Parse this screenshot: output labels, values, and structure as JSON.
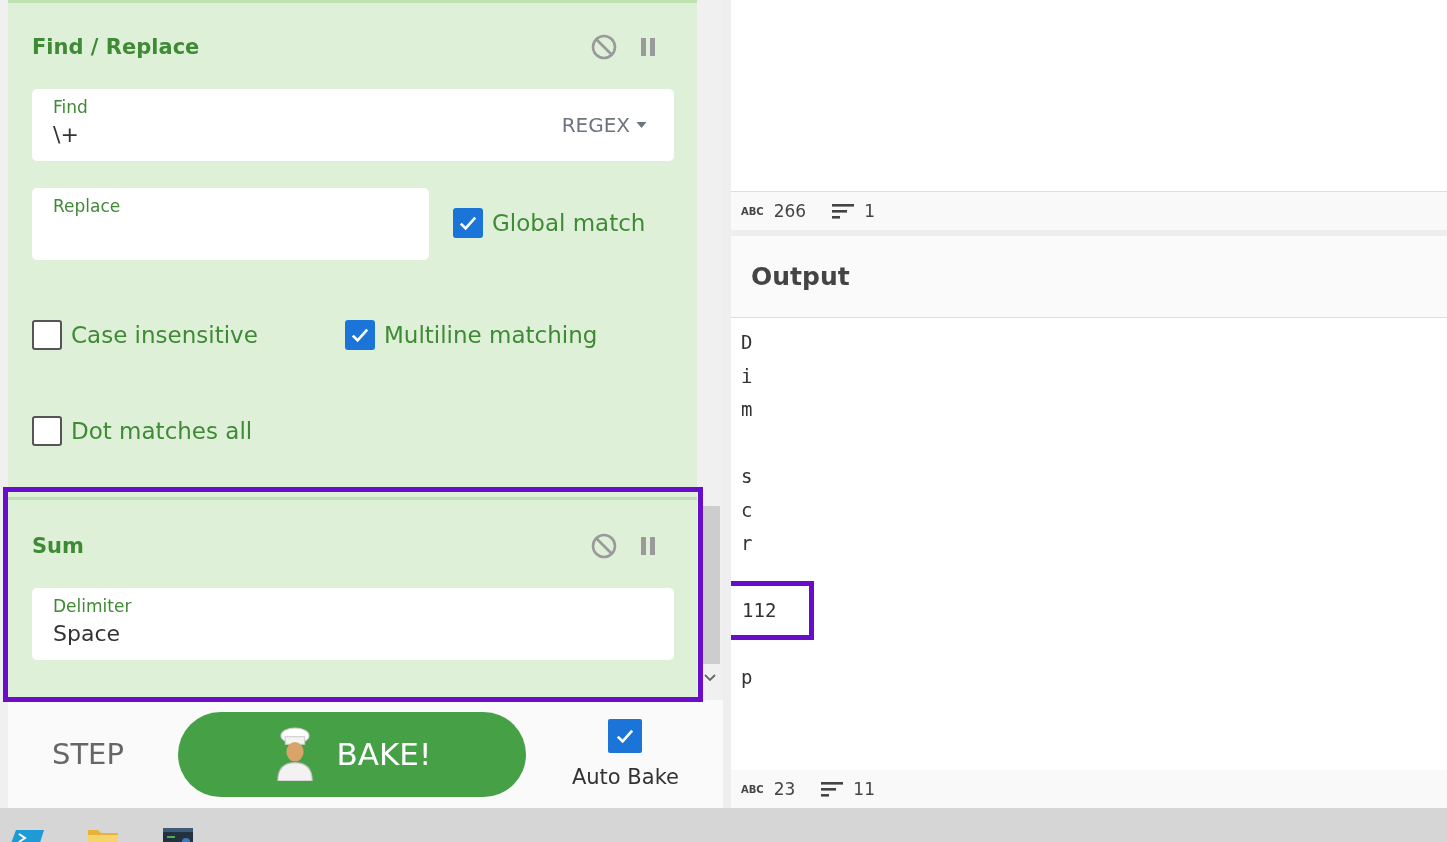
{
  "operations": [
    {
      "title": "Find / Replace",
      "highlighted": false,
      "args": [
        {
          "kind": "field",
          "label": "Find",
          "value": "\\+",
          "dropdown": "REGEX"
        },
        {
          "kind": "field",
          "label": "Replace"
        },
        {
          "kind": "checkbox",
          "label": "Global match",
          "checked": true
        },
        {
          "kind": "checkbox",
          "label": "Case insensitive",
          "checked": false
        },
        {
          "kind": "checkbox",
          "label": "Multiline matching",
          "checked": true
        },
        {
          "kind": "checkbox",
          "label": "Dot matches all",
          "checked": false
        }
      ]
    },
    {
      "title": "Sum",
      "highlighted": true,
      "args": [
        {
          "kind": "field",
          "label": "Delimiter",
          "value": "Space"
        }
      ]
    }
  ],
  "controls": {
    "step": "STEP",
    "bake": "BAKE!",
    "auto_bake": {
      "label": "Auto Bake",
      "checked": true
    }
  },
  "input_status": {
    "length_label": "ABC",
    "length": "266",
    "lines": "1"
  },
  "output": {
    "title": "Output",
    "lines": [
      {
        "kind": "text",
        "text": "D"
      },
      {
        "kind": "text",
        "text": "i"
      },
      {
        "kind": "text",
        "text": "m"
      },
      {
        "kind": "blank"
      },
      {
        "kind": "text",
        "text": "s"
      },
      {
        "kind": "text",
        "text": "c"
      },
      {
        "kind": "text",
        "text": "r"
      },
      {
        "kind": "blank"
      },
      {
        "kind": "callout",
        "text": "112"
      },
      {
        "kind": "blank"
      },
      {
        "kind": "text",
        "text": "p"
      }
    ]
  },
  "output_status": {
    "length_label": "ABC",
    "length": "23",
    "lines": "11"
  }
}
